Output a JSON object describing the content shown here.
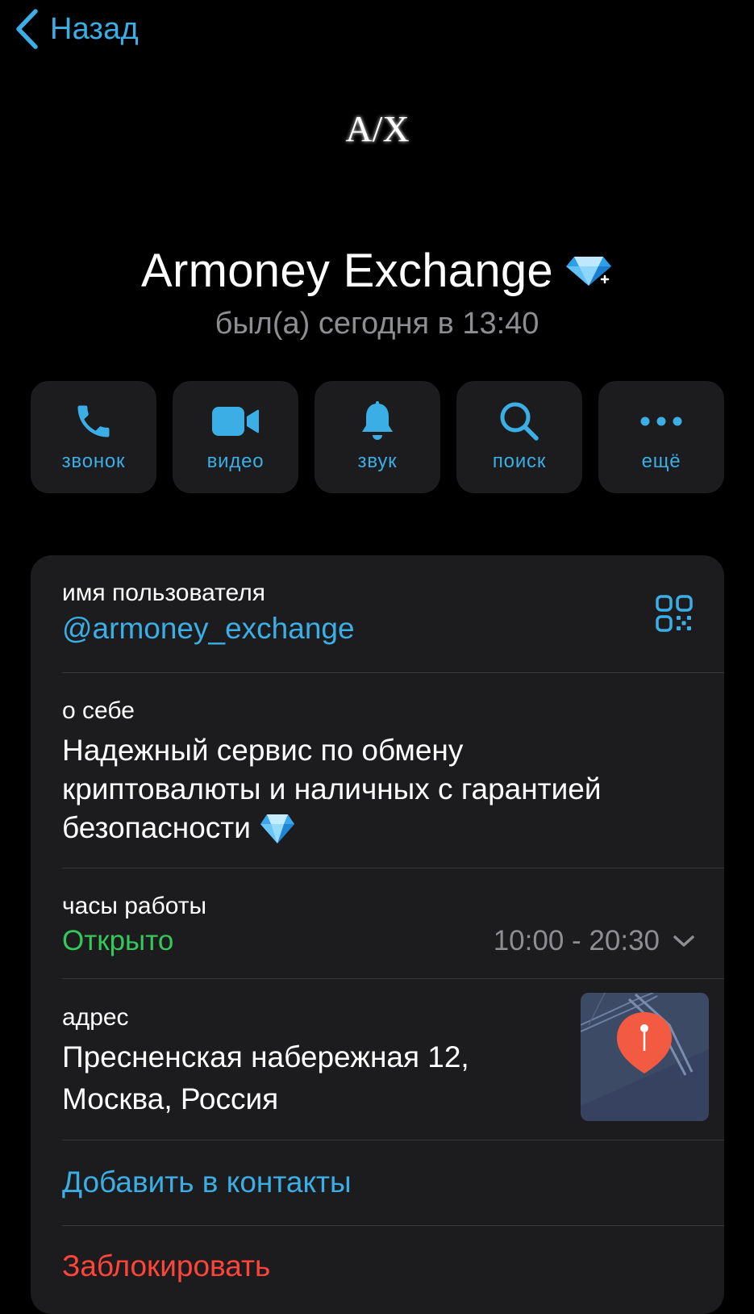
{
  "nav": {
    "back_label": "Назад"
  },
  "profile": {
    "avatar_text": "A/X",
    "name": "Armoney Exchange",
    "status": "был(а) сегодня в 13:40"
  },
  "actions": [
    {
      "label": "звонок",
      "icon": "phone-icon"
    },
    {
      "label": "видео",
      "icon": "video-camera-icon"
    },
    {
      "label": "звук",
      "icon": "bell-icon"
    },
    {
      "label": "поиск",
      "icon": "search-icon"
    },
    {
      "label": "ещё",
      "icon": "more-dots-icon"
    }
  ],
  "info": {
    "username_label": "имя пользователя",
    "username": "@armoney_exchange",
    "about_label": "о себе",
    "about_lines": [
      "Надежный сервис по обмену",
      "криптовалюты и наличных с гарантией",
      "безопасности"
    ],
    "hours_label": "часы работы",
    "hours_status": "Открыто",
    "hours_time": "10:00 - 20:30",
    "address_label": "адрес",
    "address_lines": [
      "Пресненская набережная 12,",
      "Москва, Россия"
    ],
    "add_contact": "Добавить в контакты",
    "block": "Заблокировать"
  },
  "colors": {
    "accent": "#3aaee5",
    "open_green": "#34c759",
    "danger_red": "#ff453a",
    "card_bg": "#1c1c1e",
    "secondary_text": "#8d8d92"
  }
}
